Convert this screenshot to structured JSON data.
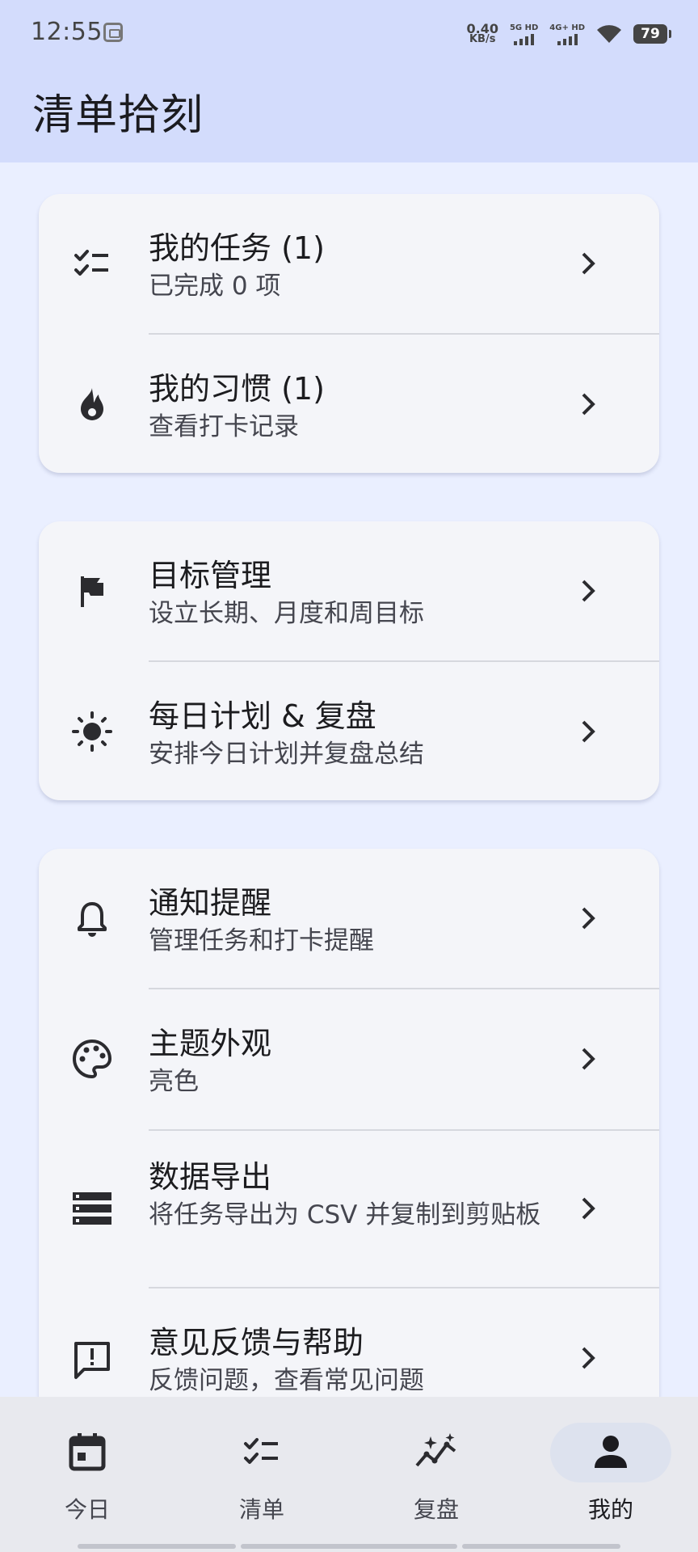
{
  "status_bar": {
    "time": "12:55",
    "net_speed_value": "0.40",
    "net_speed_unit": "KB/s",
    "sim1_label": "5G HD",
    "sim2_label": "4G+ HD",
    "battery": "79"
  },
  "header": {
    "title": "清单拾刻"
  },
  "cards": [
    {
      "rows": [
        {
          "icon": "checklist-icon",
          "title": "我的任务 (1)",
          "subtitle": "已完成 0 项"
        },
        {
          "icon": "fire-icon",
          "title": "我的习惯 (1)",
          "subtitle": "查看打卡记录"
        }
      ]
    },
    {
      "rows": [
        {
          "icon": "flag-icon",
          "title": "目标管理",
          "subtitle": "设立长期、月度和周目标"
        },
        {
          "icon": "sun-icon",
          "title": "每日计划 & 复盘",
          "subtitle": "安排今日计划并复盘总结"
        }
      ]
    },
    {
      "rows": [
        {
          "icon": "bell-icon",
          "title": "通知提醒",
          "subtitle": "管理任务和打卡提醒"
        },
        {
          "icon": "palette-icon",
          "title": "主题外观",
          "subtitle": "亮色"
        },
        {
          "icon": "storage-icon",
          "title": "数据导出",
          "subtitle": "将任务导出为 CSV 并复制到剪贴板"
        },
        {
          "icon": "feedback-icon",
          "title": "意见反馈与帮助",
          "subtitle": "反馈问题，查看常见问题"
        }
      ]
    }
  ],
  "bottom_nav": {
    "items": [
      {
        "label": "今日",
        "icon": "calendar-icon",
        "active": false
      },
      {
        "label": "清单",
        "icon": "checklist-icon",
        "active": false
      },
      {
        "label": "复盘",
        "icon": "trend-sparkle-icon",
        "active": false
      },
      {
        "label": "我的",
        "icon": "person-icon",
        "active": true
      }
    ]
  },
  "colors": {
    "header_bg": "#d3dcfc",
    "page_bg": "#eaefff",
    "card_bg": "#f4f5f9",
    "nav_bg": "#e8e9ee",
    "active_pill": "#dde2ee"
  }
}
